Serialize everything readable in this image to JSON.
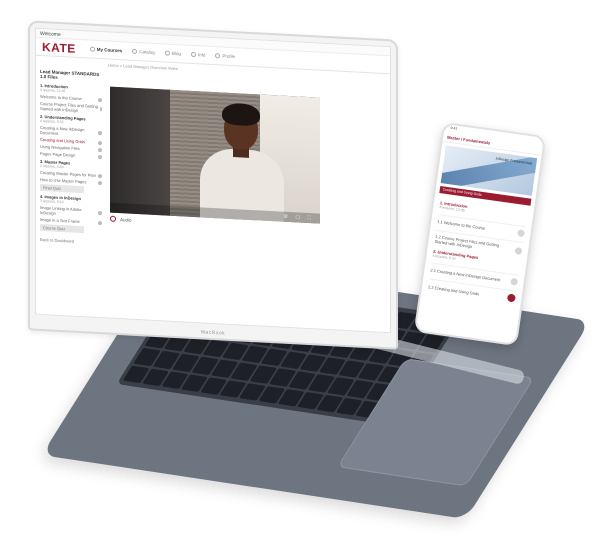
{
  "laptop": {
    "lid_brand": "MacBook",
    "topbar": "Welcome",
    "logo": "KATE",
    "nav": [
      "My Courses",
      "Catalog",
      "Blog",
      "Info",
      "Profile"
    ],
    "breadcrumb": "Home  >  Lead Manager Overview Video",
    "sidebar": {
      "course_title": "Lead Manager STANDARDS 1.0 Files",
      "sections": [
        {
          "title": "1. Introduction",
          "sub": "4 lessons, 12:35",
          "lessons": [
            "Welcome to the Course",
            "Course Project Files and Getting Started with InDesign"
          ]
        },
        {
          "title": "2. Understanding Pages",
          "sub": "4 lessons, 9:32",
          "lessons": [
            "Creating a New InDesign Document",
            "Creating and Using Grids",
            "Using Navigation Files",
            "Pages Page Design"
          ]
        },
        {
          "title": "3. Master Pages",
          "sub": "2 lessons, 4:40",
          "lessons": [
            "Creating Master Pages for Plan",
            "How to Use Master Pages"
          ]
        },
        {
          "title": "4. Images in InDesign",
          "sub": "3 lessons, 8:10",
          "lessons": [
            "Image Linking in Adobe InDesign",
            "Image in a Text Frame"
          ]
        }
      ],
      "quiz_labels": [
        "Final Quiz",
        "Course Quiz"
      ],
      "footer": "Back to Dashboard"
    },
    "below_video": "Audio"
  },
  "phone": {
    "status": "9:41",
    "header": "Master / Fundamentals",
    "hero_text": "InDesign Fundamentals",
    "tab": "Creating and Using Grids",
    "list": [
      {
        "type": "section",
        "title": "1. Introduction",
        "sub": "4 lessons, 12:35"
      },
      {
        "type": "item",
        "label": "1.1 Welcome to the Course"
      },
      {
        "type": "item",
        "label": "1.2 Course Project Files and Getting Started with InDesign"
      },
      {
        "type": "section",
        "title": "2. Understanding Pages",
        "sub": "4 lessons, 9:32"
      },
      {
        "type": "item",
        "label": "2.1 Creating a New InDesign Document"
      },
      {
        "type": "item",
        "label": "2.2 Creating and Using Grids",
        "playing": true
      }
    ]
  }
}
